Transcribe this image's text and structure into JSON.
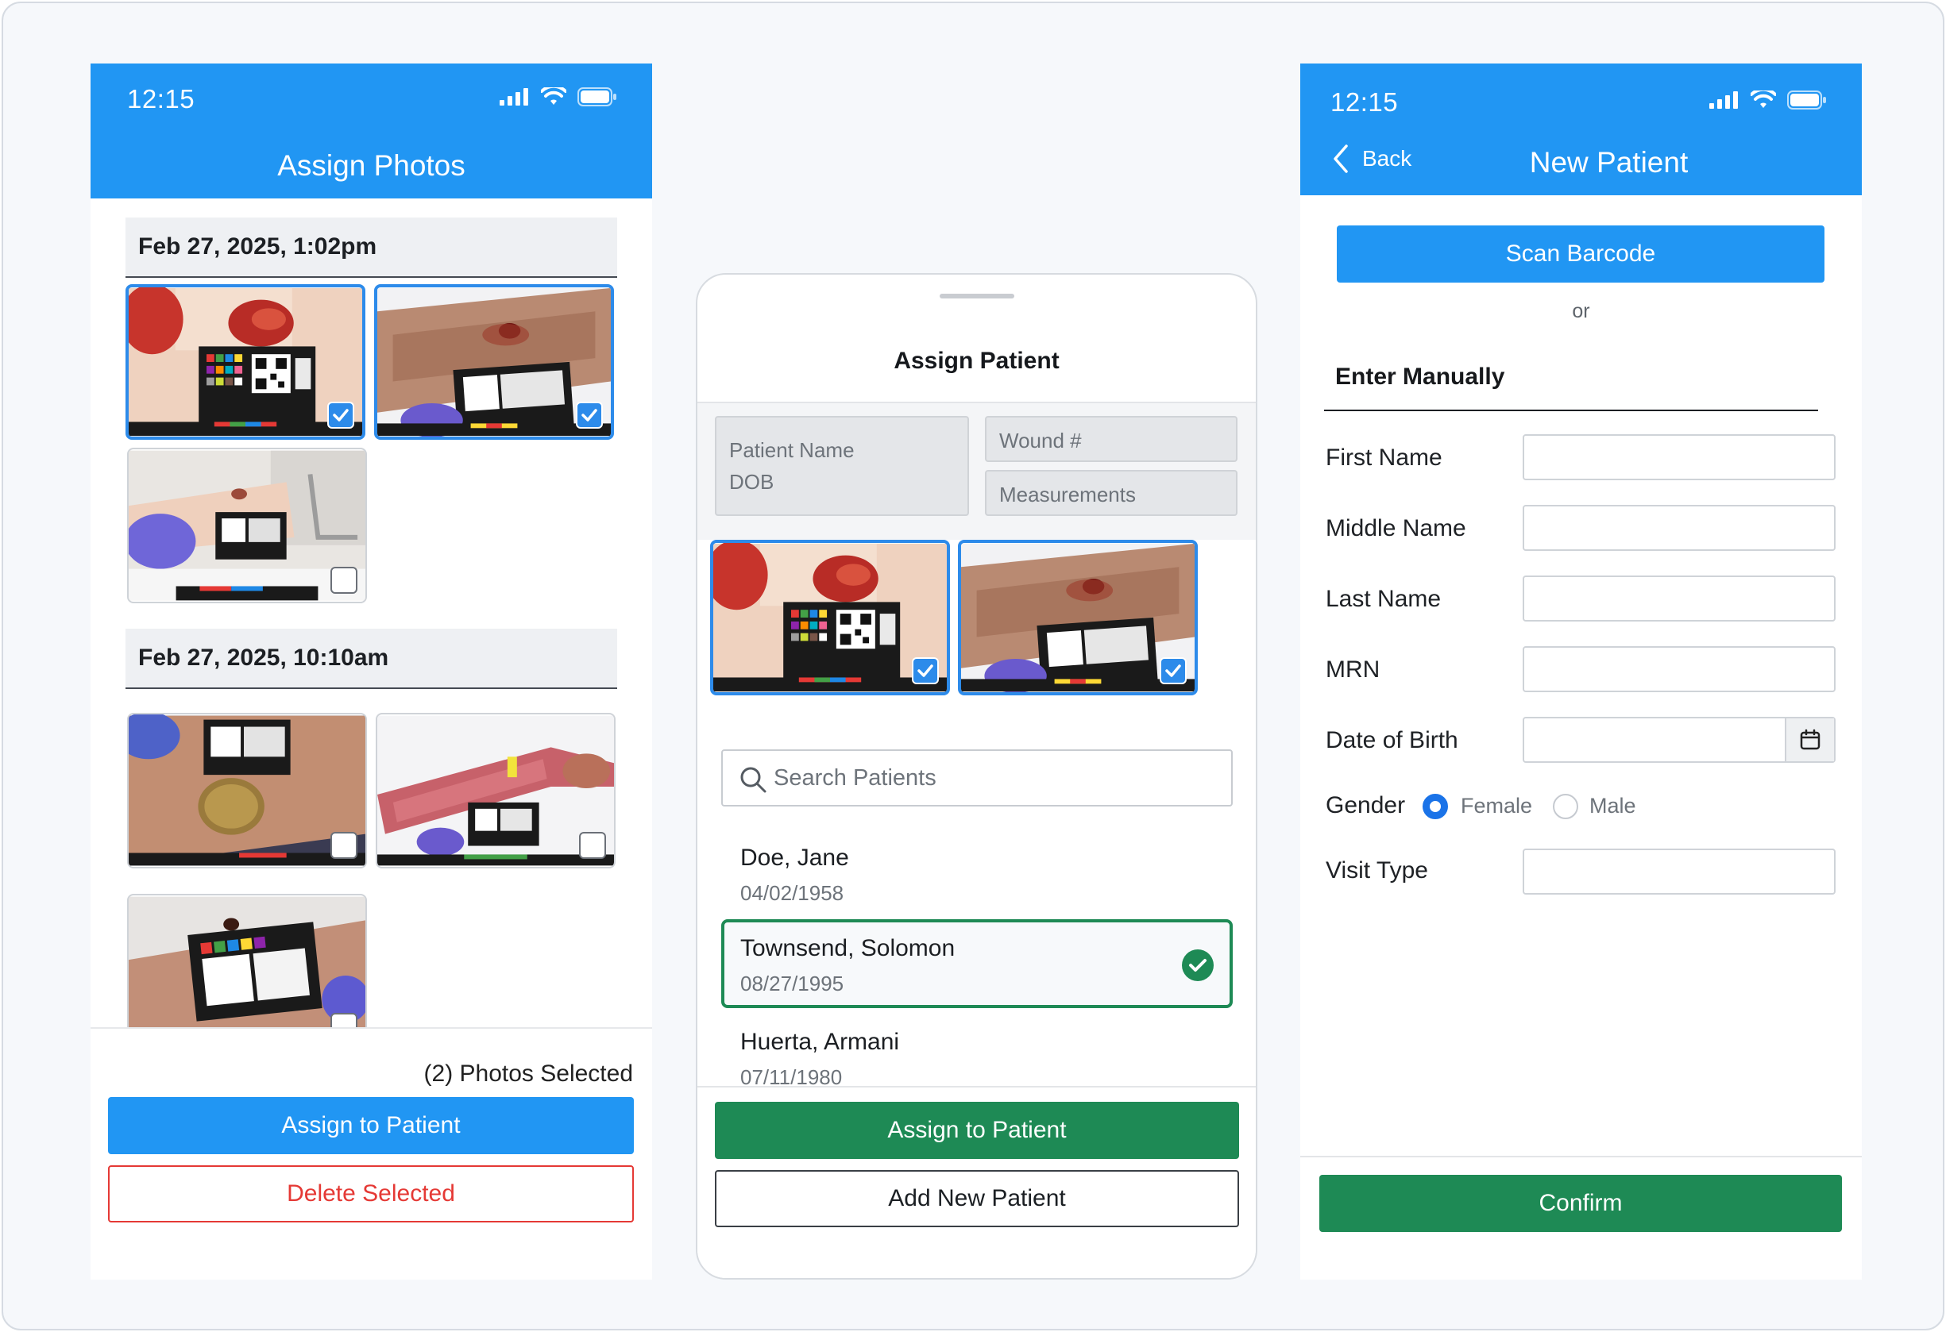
{
  "status": {
    "time": "12:15"
  },
  "assign_photos": {
    "title": "Assign Photos",
    "groups": [
      {
        "date": "Feb 27, 2025, 1:02pm"
      },
      {
        "date": "Feb 27, 2025, 10:10am"
      }
    ],
    "photos": [
      {
        "group": 0,
        "selected": true
      },
      {
        "group": 0,
        "selected": true
      },
      {
        "group": 0,
        "selected": false
      },
      {
        "group": 1,
        "selected": false
      },
      {
        "group": 1,
        "selected": false
      },
      {
        "group": 1,
        "selected": false
      }
    ],
    "selected_count_label": "(2) Photos Selected",
    "assign_button": "Assign to Patient",
    "delete_button": "Delete Selected"
  },
  "assign_patient": {
    "title": "Assign Patient",
    "patient_name_placeholder": "Patient Name",
    "dob_placeholder": "DOB",
    "wound_placeholder": "Wound #",
    "measurements_placeholder": "Measurements",
    "search_placeholder": "Search Patients",
    "patients": [
      {
        "name": "Doe, Jane",
        "dob": "04/02/1958",
        "selected": false
      },
      {
        "name": "Townsend, Solomon",
        "dob": "08/27/1995",
        "selected": true
      },
      {
        "name": "Huerta, Armani",
        "dob": "07/11/1980",
        "selected": false
      }
    ],
    "assign_button": "Assign to Patient",
    "add_button": "Add New Patient"
  },
  "new_patient": {
    "back_label": "Back",
    "title": "New Patient",
    "scan_button": "Scan Barcode",
    "or_text": "or",
    "section_title": "Enter Manually",
    "fields": {
      "first_name": "First Name",
      "middle_name": "Middle Name",
      "last_name": "Last Name",
      "mrn": "MRN",
      "dob": "Date of Birth",
      "gender": "Gender",
      "visit_type": "Visit Type"
    },
    "gender_options": [
      "Female",
      "Male"
    ],
    "gender_selected": "Female",
    "confirm_button": "Confirm"
  },
  "colors": {
    "header_blue": "#2196f3",
    "action_green": "#1e8a55",
    "danger_red": "#e53935",
    "selection_blue": "#2d8bea"
  }
}
